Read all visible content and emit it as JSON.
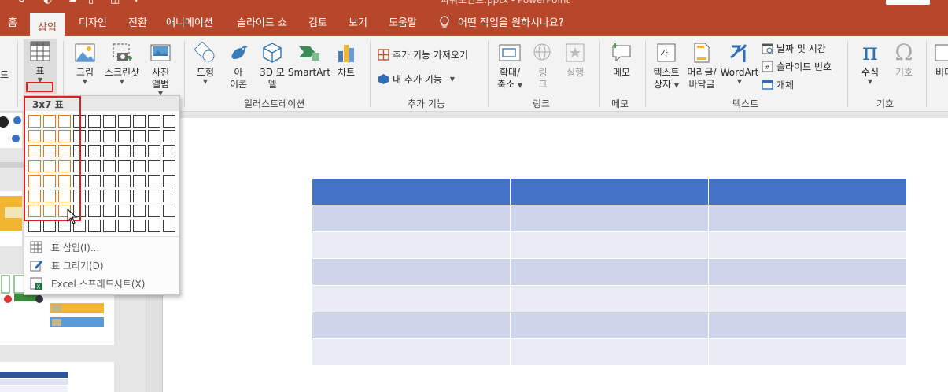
{
  "titlebar": {
    "title": "파워포인트.pptx - PowerPoint"
  },
  "tabs": [
    {
      "label": "홈"
    },
    {
      "label": "삽입"
    },
    {
      "label": "디자인"
    },
    {
      "label": "전환"
    },
    {
      "label": "애니메이션"
    },
    {
      "label": "슬라이드 쇼"
    },
    {
      "label": "검토"
    },
    {
      "label": "보기"
    },
    {
      "label": "도움말"
    }
  ],
  "tell_me": {
    "label": "어떤 작업을 원하시나요?"
  },
  "ribbon": {
    "left_partial": "드",
    "table_button": {
      "label": "표"
    },
    "images": {
      "picture": "그림",
      "screenshot": "스크린샷",
      "album_line1": "사진",
      "album_line2": "앨범"
    },
    "illustrations": {
      "shapes": "도형",
      "icons_line1": "아",
      "icons_line2": "이콘",
      "models_line1": "3D 모",
      "models_line2": "델",
      "smartart": "SmartArt",
      "chart": "차트",
      "group_label": "일러스트레이션"
    },
    "addins": {
      "get_addins": "추가 기능 가져오기",
      "my_addins": "내 추가 기능",
      "group_label": "추가 기능"
    },
    "links": {
      "zoom_line1": "확대/",
      "zoom_line2": "축소",
      "link_line1": "링",
      "link_line2": "크",
      "action": "실행",
      "group_label": "링크"
    },
    "comments": {
      "comment": "메모",
      "group_label": "메모"
    },
    "text": {
      "textbox_line1": "텍스트",
      "textbox_line2": "상자",
      "header_line1": "머리글/",
      "header_line2": "바닥글",
      "wordart": "WordArt",
      "datetime": "날짜 및 시간",
      "slide_number": "슬라이드 번호",
      "object": "개체",
      "group_label": "텍스트"
    },
    "symbols": {
      "equation": "수식",
      "symbol": "기호",
      "group_label": "기호"
    },
    "media_partial": "비디"
  },
  "table_dropdown": {
    "title": "3x7 표",
    "grid_cols": 10,
    "grid_rows": 8,
    "selected_cols": 3,
    "selected_rows": 7,
    "insert_table": "표 삽입(I)...",
    "draw_table": "표 그리기(D)",
    "excel_sheet": "Excel 스프레드시트(X)"
  },
  "colors": {
    "accent": "#b7472a",
    "table_header": "#4472c4",
    "table_band1": "#cfd5ea",
    "table_band2": "#e9ebf5",
    "grid_selected": "#e07b1a",
    "highlight_box": "#e02020"
  }
}
